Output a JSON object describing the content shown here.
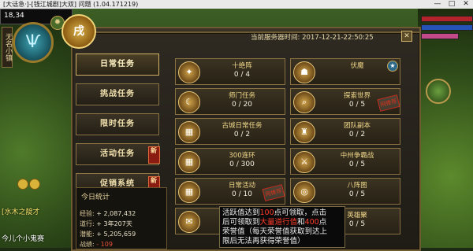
{
  "window": {
    "title": "[大话急·]-[钱江城剧]大双] 问题 (1.04.171219)",
    "controls": [
      "—",
      "□",
      "✕"
    ]
  },
  "hud": {
    "hp_value": "18,34",
    "vertical_label": "无名小镇",
    "emblem_glyph": "Ѱ",
    "window_badge": "戌",
    "player_name": "[水木之靛才",
    "player_name_2": "今儿个小鬼赛"
  },
  "panel": {
    "server_time_label": "当前服务器时间:",
    "server_time_value": "2017-12-21-22:50:25",
    "close_icon": "close-icon"
  },
  "nav": [
    {
      "label": "日常任务",
      "active": true,
      "new": false
    },
    {
      "label": "挑战任务",
      "active": false,
      "new": false
    },
    {
      "label": "限时任务",
      "active": false,
      "new": false
    },
    {
      "label": "活动任务",
      "active": false,
      "new": true
    },
    {
      "label": "促销系统",
      "active": false,
      "new": true
    }
  ],
  "new_tag": "新",
  "stats": {
    "title": "今日统计",
    "rows": [
      {
        "label": "经验:",
        "value": "+ 2,087,432",
        "red": false
      },
      {
        "label": "道行:",
        "value": "+ 3年207天",
        "red": false
      },
      {
        "label": "潜能:",
        "value": "+ 5,205,659",
        "red": false
      },
      {
        "label": "战绩:",
        "value": "- 109",
        "red": true
      }
    ]
  },
  "tasks": [
    {
      "name": "十绝阵",
      "progress": "0 / 4",
      "icon": "seal-icon",
      "stamp": "",
      "corner": false
    },
    {
      "name": "伏魔",
      "progress": "",
      "icon": "demon-icon",
      "stamp": "",
      "corner": true
    },
    {
      "name": "师门任务",
      "progress": "0 / 20",
      "icon": "scythe-icon",
      "stamp": "",
      "corner": false
    },
    {
      "name": "探索世界",
      "progress": "0 / 5",
      "icon": "magnifier-icon",
      "stamp": "网推荐",
      "corner": false
    },
    {
      "name": "古城日常任务",
      "progress": "0 / 2",
      "icon": "calendar-icon",
      "stamp": "",
      "corner": false
    },
    {
      "name": "团队副本",
      "progress": "0 / 2",
      "icon": "team-icon",
      "stamp": "",
      "corner": false
    },
    {
      "name": "300连环",
      "progress": "0 / 300",
      "icon": "calendar-icon",
      "stamp": "",
      "corner": false
    },
    {
      "name": "中州争霸战",
      "progress": "0 / 5",
      "icon": "battle-icon",
      "stamp": "",
      "corner": false
    },
    {
      "name": "日常活动",
      "progress": "0 / 10",
      "icon": "calendar-icon",
      "stamp": "网推荐",
      "corner": false
    },
    {
      "name": "八阵图",
      "progress": "0 / 5",
      "icon": "formation-icon",
      "stamp": "",
      "corner": false
    },
    {
      "name": "",
      "progress": "",
      "icon": "scroll-icon",
      "stamp": "",
      "corner": false
    },
    {
      "name": "英雄聚",
      "progress": "0 / 5",
      "icon": "hero-icon",
      "stamp": "",
      "corner": false
    }
  ],
  "tooltip": {
    "line1_a": "活跃值达到",
    "line1_b": "100",
    "line1_c": "点可领取，点击",
    "line2_a": "后可领取到",
    "line2_b": "大量道行值",
    "line2_c": "和",
    "line2_d": "400",
    "line2_e": "点",
    "line3": "荣誉值（每天荣誉值获取到达上",
    "line4": "限后无法再获得荣誉值）"
  },
  "colors": {
    "panel_border": "#6e5a33",
    "highlight_red": "#ff3b2a",
    "gold_text": "#f0d88a"
  }
}
